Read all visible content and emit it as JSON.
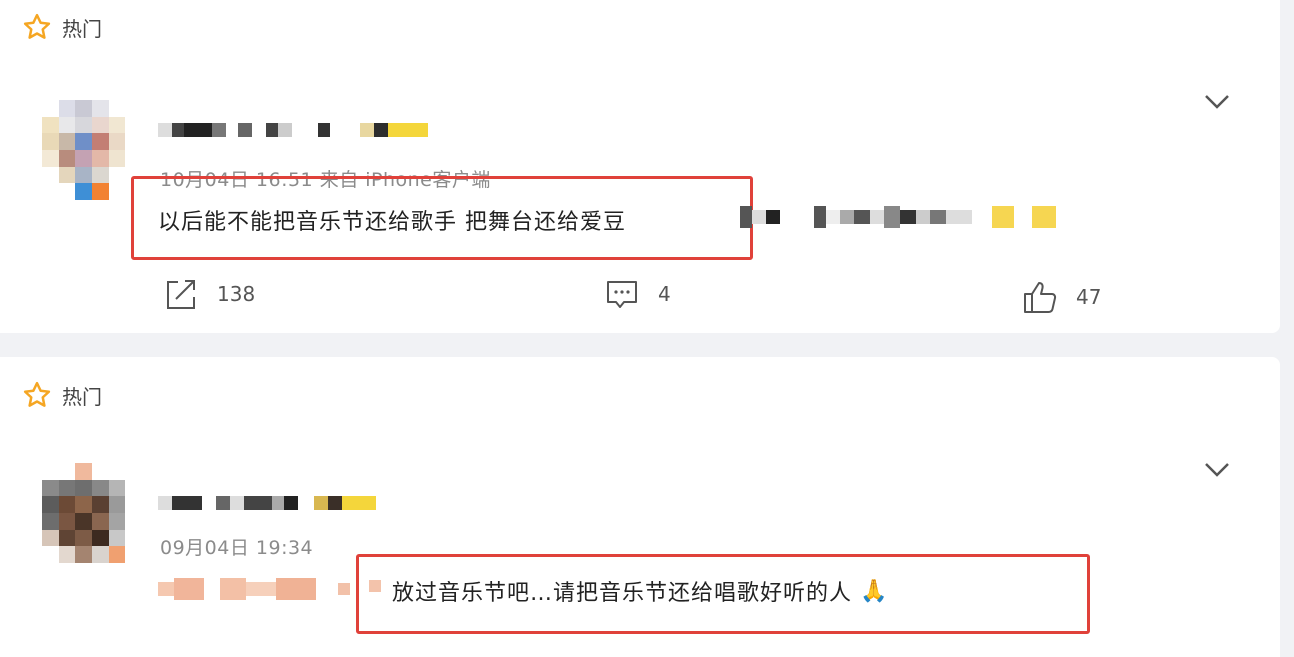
{
  "posts": [
    {
      "hot_label": "热门",
      "meta": "10月04日 16:51  来自  iPhone客户端",
      "content": "以后能不能把音乐节还给歌手 把舞台还给爱豆",
      "actions": {
        "share_count": "138",
        "comment_count": "4",
        "like_count": "47"
      }
    },
    {
      "hot_label": "热门",
      "meta": "09月04日 19:34",
      "content": "放过音乐节吧…请把音乐节还给唱歌好听的人",
      "emoji": "🙏"
    }
  ],
  "colors": {
    "highlight_border": "#e0413a",
    "hot_star": "#f5a623"
  }
}
